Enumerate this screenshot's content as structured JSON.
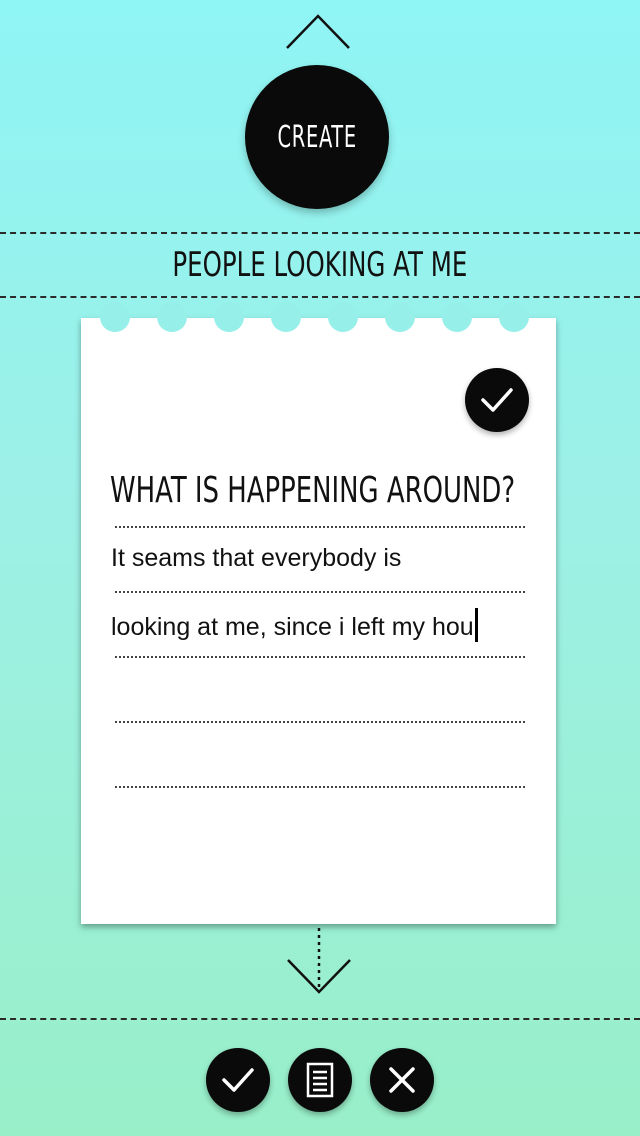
{
  "header": {
    "create_label": "CREATE",
    "category_title": "PEOPLE LOOKING AT ME"
  },
  "note": {
    "question": "WHAT IS HAPPENING AROUND?",
    "lines": [
      "It seams that everybody is",
      "looking at me, since i left my hou"
    ]
  },
  "icons": {
    "collapse": "chevron-up-icon",
    "save": "check-icon",
    "expand": "arrow-down-icon",
    "confirm": "check-icon",
    "notes": "document-icon",
    "close": "close-icon"
  },
  "colors": {
    "background_top": "#8ff5f5",
    "background_bottom": "#98efc8",
    "button": "#0a0a0a"
  }
}
